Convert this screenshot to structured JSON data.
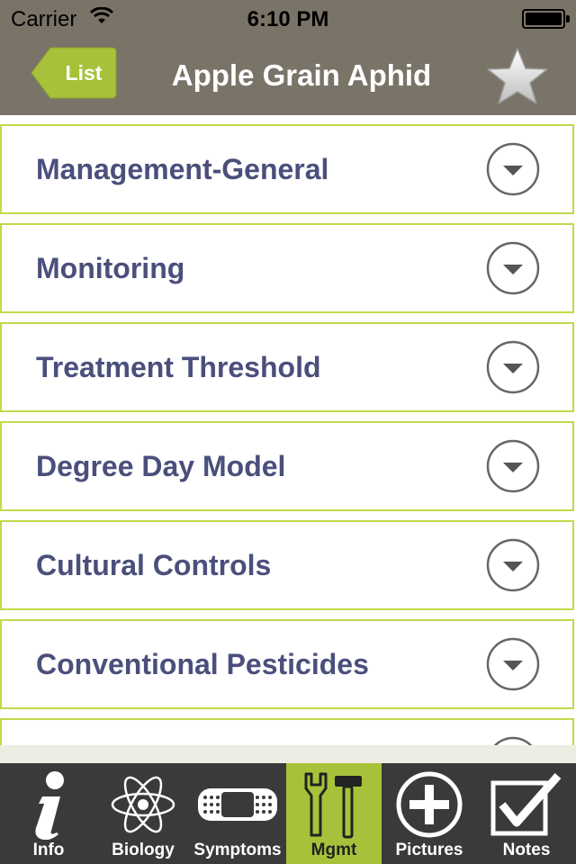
{
  "status": {
    "carrier": "Carrier",
    "time": "6:10 PM"
  },
  "nav": {
    "back_label": "List",
    "title": "Apple Grain Aphid"
  },
  "sections": [
    {
      "label": "Management-General"
    },
    {
      "label": "Monitoring"
    },
    {
      "label": "Treatment Threshold"
    },
    {
      "label": "Degree Day Model"
    },
    {
      "label": "Cultural Controls"
    },
    {
      "label": "Conventional Pesticides"
    }
  ],
  "tabs": [
    {
      "label": "Info",
      "icon": "info-icon"
    },
    {
      "label": "Biology",
      "icon": "atom-icon"
    },
    {
      "label": "Symptoms",
      "icon": "bandage-icon"
    },
    {
      "label": "Mgmt",
      "icon": "tools-icon",
      "active": true
    },
    {
      "label": "Pictures",
      "icon": "plus-circle-icon"
    },
    {
      "label": "Notes",
      "icon": "checkbox-icon"
    }
  ],
  "colors": {
    "bar": "#7a7468",
    "accent": "#a7c23a",
    "item_border": "#c4d94a",
    "item_text": "#4a4f7c",
    "tabbar": "#3a3a3a"
  }
}
